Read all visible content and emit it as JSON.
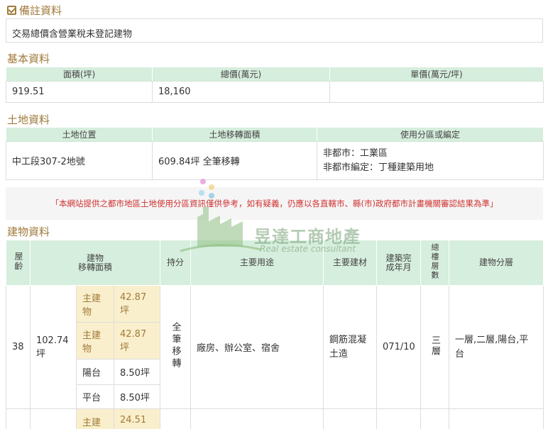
{
  "remarks": {
    "title": "備註資料",
    "text": "交易總價含營業稅未登記建物"
  },
  "basic": {
    "title": "基本資料",
    "headers": [
      "面積(坪)",
      "總價(萬元)",
      "單價(萬元/坪)"
    ],
    "values": [
      "919.51",
      "18,160",
      ""
    ]
  },
  "land": {
    "title": "土地資料",
    "headers": [
      "土地位置",
      "土地移轉面積",
      "使用分區或編定"
    ],
    "location": "中工段307-2地號",
    "area": "609.84坪 全筆移轉",
    "zoning_line1": "非都市：工業區",
    "zoning_line2": "非都市編定：丁種建築用地"
  },
  "warning": "「本網站提供之都市地區土地使用分區資訊僅供參考，如有疑義，仍應以各直轄市、縣(市)政府都市計畫機關審認結果為準」",
  "watermark": {
    "name": "昱達工商地產",
    "sub": "Real estate consultant"
  },
  "building": {
    "title": "建物資料",
    "headers": {
      "age": "屋齡",
      "area": "建物\n移轉面積",
      "share": "持分",
      "use": "主要用途",
      "material": "主要建材",
      "completed": "建築完成年月",
      "floors": "總樓層數",
      "floor_split": "建物分層"
    },
    "row1": {
      "age": "38",
      "total_area": "102.74坪",
      "parts": [
        {
          "label": "主建物",
          "value": "42.87坪"
        },
        {
          "label": "主建物",
          "value": "42.87坪"
        },
        {
          "label": "陽台",
          "value": "8.50坪"
        },
        {
          "label": "平台",
          "value": "8.50坪"
        }
      ],
      "share": "全筆移轉",
      "use": "廠房、辦公室、宿舍",
      "material": "鋼筋混凝土造",
      "completed": "071/10",
      "floors": "三層",
      "floor_split": "一層,二層,陽台,平台"
    },
    "row2": {
      "part_label": "主建",
      "part_value": "24.51"
    }
  },
  "colors": {
    "accent": "#a07a3a",
    "header_bg": "#d6eedd",
    "highlight_bg": "#faefcc",
    "warning": "#d03030"
  }
}
